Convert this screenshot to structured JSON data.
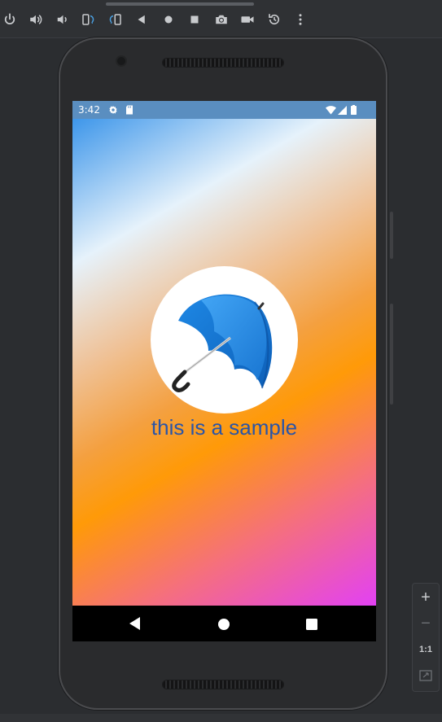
{
  "toolbar": {
    "icons": [
      "power-icon",
      "volume-up-icon",
      "volume-down-icon",
      "rotate-left-icon",
      "rotate-right-icon",
      "back-icon",
      "home-icon",
      "overview-icon",
      "screenshot-icon",
      "record-icon",
      "reset-icon",
      "more-icon"
    ]
  },
  "status_bar": {
    "time": "3:42",
    "icons": [
      "settings-icon",
      "sd-card-icon",
      "wifi-icon",
      "signal-icon",
      "battery-icon"
    ]
  },
  "app": {
    "sample_text": "this is a sample",
    "logo": "umbrella-logo",
    "gradient": [
      "#3d96ea",
      "#e6f2fb",
      "#ff9a08",
      "#e241f4"
    ]
  },
  "nav_bar": {
    "icons": [
      "back-triangle-icon",
      "home-circle-icon",
      "recents-square-icon"
    ]
  },
  "zoom": {
    "plus": "+",
    "minus": "−",
    "one_to_one": "1:1"
  },
  "colors": {
    "status_bar_bg": "#5a8ec0",
    "text_blue": "#2a55a8",
    "accent_blue": "#2196f3"
  }
}
